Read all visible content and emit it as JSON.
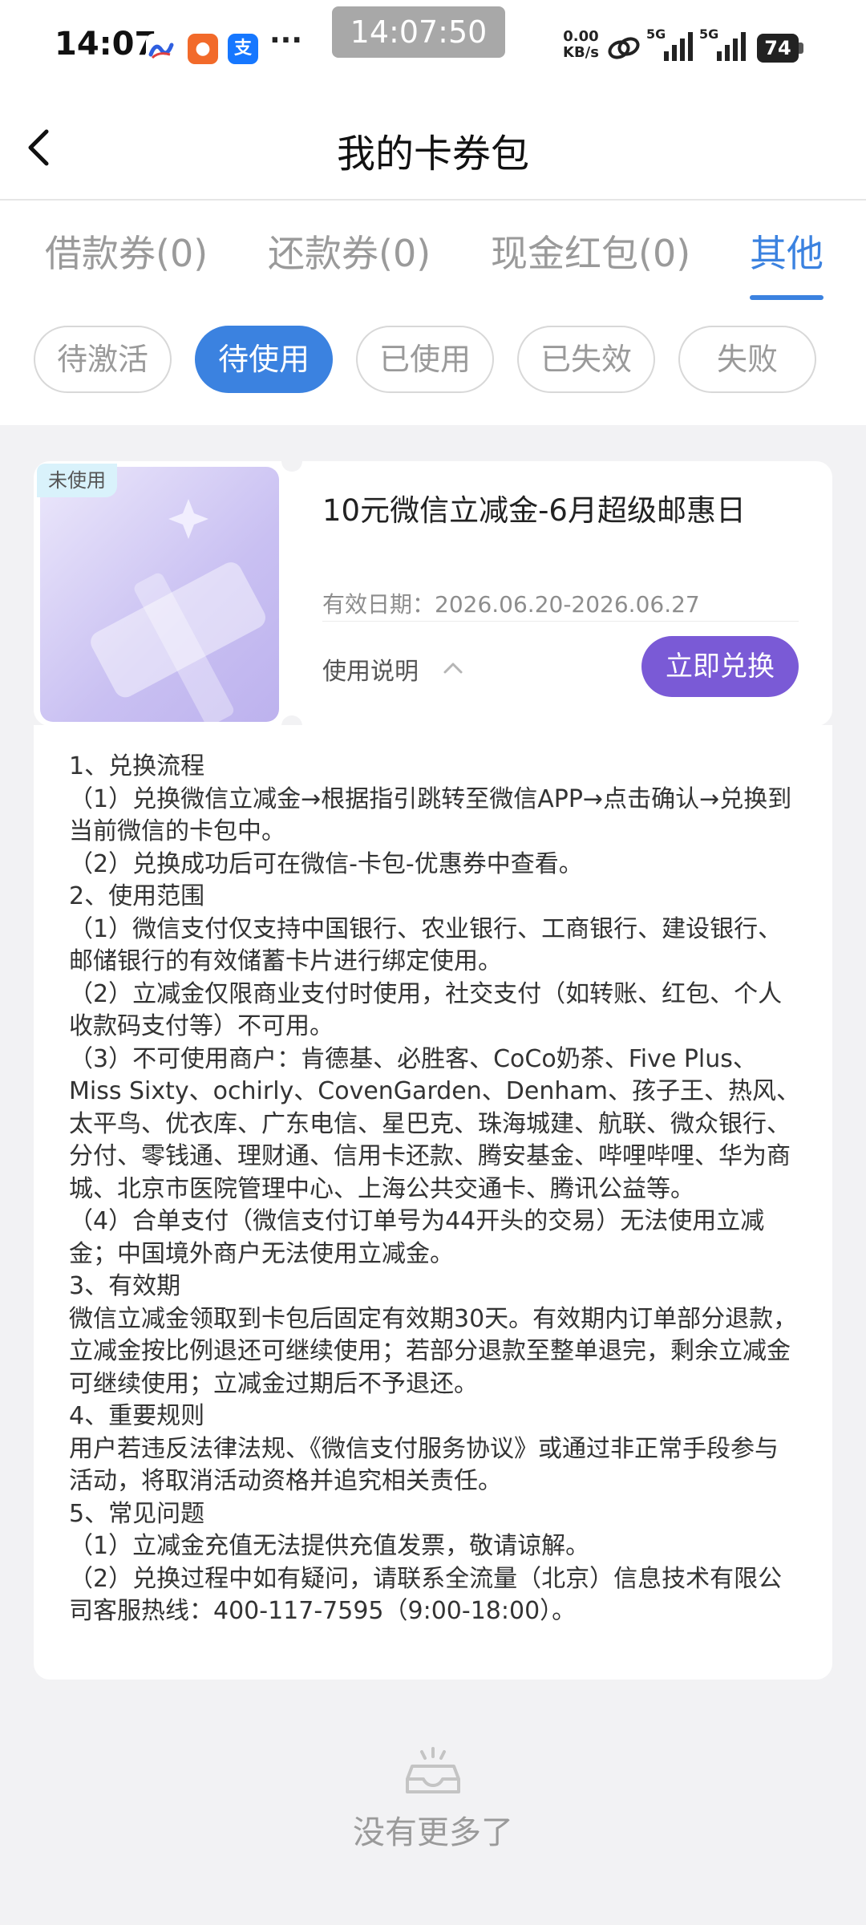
{
  "status_bar": {
    "time": "14:07",
    "clock_overlay": "14:07:50",
    "net_speed_value": "0.00",
    "net_speed_unit": "KB/s",
    "signal_1_label": "5G",
    "signal_2_label": "5G",
    "battery": "74",
    "more_dots": "···",
    "app_icons": [
      "app-icon-1",
      "app-icon-2",
      "alipay-icon"
    ]
  },
  "nav": {
    "title": "我的卡券包",
    "back_icon": "chevron-left-icon"
  },
  "tabs": [
    {
      "label": "借款券(0)",
      "active": false
    },
    {
      "label": "还款券(0)",
      "active": false
    },
    {
      "label": "现金红包(0)",
      "active": false
    },
    {
      "label": "其他",
      "active": true
    }
  ],
  "filters": [
    {
      "label": "待激活",
      "active": false
    },
    {
      "label": "待使用",
      "active": true
    },
    {
      "label": "已使用",
      "active": false
    },
    {
      "label": "已失效",
      "active": false
    },
    {
      "label": "失败",
      "active": false
    }
  ],
  "coupon": {
    "status_badge": "未使用",
    "title": "10元微信立减金-6月超级邮惠日",
    "validity": "有效日期：2026.06.20-2026.06.27",
    "usage_label": "使用说明",
    "redeem_label": "立即兑换"
  },
  "instructions": [
    "1、兑换流程",
    "（1）兑换微信立减金→根据指引跳转至微信APP→点击确认→兑换到当前微信的卡包中。",
    "（2）兑换成功后可在微信-卡包-优惠券中查看。",
    "2、使用范围",
    "（1）微信支付仅支持中国银行、农业银行、工商银行、建设银行、邮储银行的有效储蓄卡片进行绑定使用。",
    "（2）立减金仅限商业支付时使用，社交支付（如转账、红包、个人收款码支付等）不可用。",
    "（3）不可使用商户：肯德基、必胜客、CoCo奶茶、Five Plus、Miss Sixty、ochirly、CovenGarden、Denham、孩子王、热风、太平鸟、优衣库、广东电信、星巴克、珠海城建、航联、微众银行、分付、零钱通、理财通、信用卡还款、腾安基金、哔哩哔哩、华为商城、北京市医院管理中心、上海公共交通卡、腾讯公益等。",
    "（4）合单支付（微信支付订单号为44开头的交易）无法使用立减金；中国境外商户无法使用立减金。",
    "3、有效期",
    "微信立减金领取到卡包后固定有效期30天。有效期内订单部分退款，立减金按比例退还可继续使用；若部分退款至整单退完，剩余立减金可继续使用；立减金过期后不予退还。",
    "4、重要规则",
    "用户若违反法律法规、《微信支付服务协议》或通过非正常手段参与活动，将取消活动资格并追究相关责任。",
    "5、常见问题",
    "（1）立减金充值无法提供充值发票，敬请谅解。",
    "（2）兑换过程中如有疑问，请联系全流量（北京）信息技术有限公司客服热线：400-117-7595（9:00-18:00）。"
  ],
  "empty_state": {
    "text": "没有更多了",
    "icon": "empty-inbox-icon"
  },
  "colors": {
    "accent_blue": "#3b82e0",
    "redeem_purple": "#7a5ad6",
    "background": "#f2f2f4"
  }
}
